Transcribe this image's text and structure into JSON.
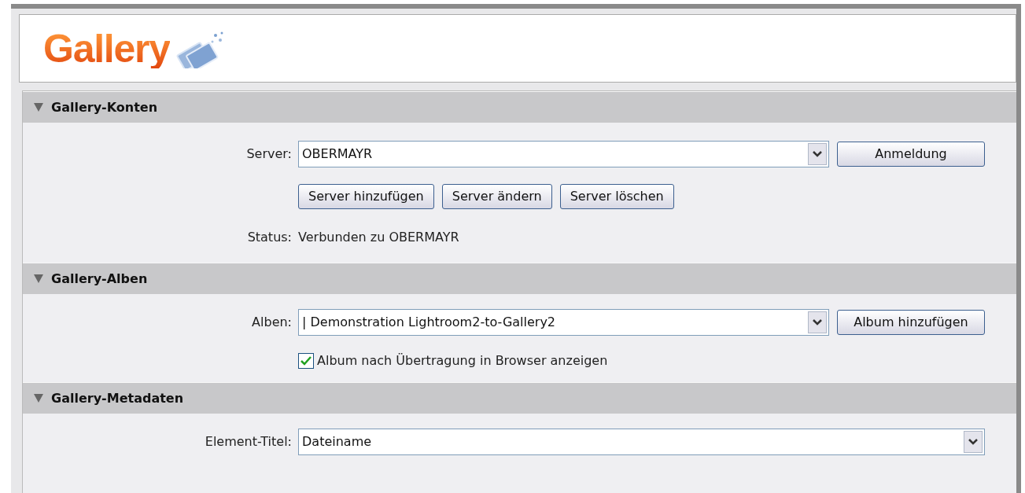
{
  "logo": {
    "text": "Gallery"
  },
  "sections": [
    {
      "title": "Gallery-Konten",
      "expanded": true,
      "rows": [
        {
          "kind": "select",
          "label": "Server:",
          "value": "OBERMAYR",
          "button": "Anmeldung"
        },
        {
          "kind": "buttons",
          "buttons": [
            "Server hinzufügen",
            "Server ändern",
            "Server löschen"
          ]
        },
        {
          "kind": "text",
          "label": "Status:",
          "value": "Verbunden zu OBERMAYR"
        }
      ]
    },
    {
      "title": "Gallery-Alben",
      "expanded": true,
      "rows": [
        {
          "kind": "select",
          "label": "Alben:",
          "value": "| Demonstration Lightroom2-to-Gallery2",
          "button": "Album hinzufügen"
        },
        {
          "kind": "checkbox",
          "label": "Album nach Übertragung in Browser anzeigen",
          "checked": true
        }
      ]
    },
    {
      "title": "Gallery-Metadaten",
      "expanded": true,
      "rows": [
        {
          "kind": "select",
          "label": "Element-Titel:",
          "value": "Dateiname"
        }
      ]
    }
  ]
}
